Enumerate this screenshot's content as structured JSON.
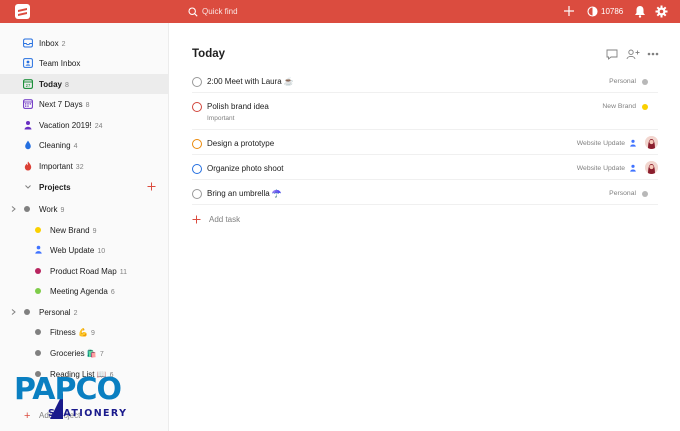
{
  "header": {
    "search_placeholder": "Quick find",
    "karma": "10786",
    "accent": "#db4c3f"
  },
  "sidebar": {
    "nav": [
      {
        "label": "Inbox",
        "count": "2",
        "icon": "inbox-icon",
        "color": "#246fe0"
      },
      {
        "label": "Team Inbox",
        "count": "",
        "icon": "team-inbox-icon",
        "color": "#246fe0"
      },
      {
        "label": "Today",
        "count": "8",
        "icon": "calendar-today-icon",
        "color": "#058527",
        "day": "27"
      },
      {
        "label": "Next 7 Days",
        "count": "8",
        "icon": "calendar-week-icon",
        "color": "#692fc2"
      },
      {
        "label": "Vacation 2019!",
        "count": "24",
        "icon": "person-icon",
        "color": "#692fc2"
      },
      {
        "label": "Cleaning",
        "count": "4",
        "icon": "drop-icon",
        "color": "#246fe0"
      },
      {
        "label": "Important",
        "count": "32",
        "icon": "flame-icon",
        "color": "#db4035"
      }
    ],
    "projects_label": "Projects",
    "projects": [
      {
        "label": "Work",
        "count": "9",
        "level": 0,
        "kind": "dot",
        "color": "#808080",
        "expandable": true
      },
      {
        "label": "New Brand",
        "count": "9",
        "level": 1,
        "kind": "dot",
        "color": "#fad000"
      },
      {
        "label": "Web Update",
        "count": "10",
        "level": 1,
        "kind": "person",
        "color": "#4073ff"
      },
      {
        "label": "Product Road Map",
        "count": "11",
        "level": 1,
        "kind": "dot",
        "color": "#b8255f"
      },
      {
        "label": "Meeting Agenda",
        "count": "6",
        "level": 1,
        "kind": "dot",
        "color": "#7ecc49"
      },
      {
        "label": "Personal",
        "count": "2",
        "level": 0,
        "kind": "dot",
        "color": "#808080",
        "expandable": true
      },
      {
        "label": "Fitness 💪",
        "count": "9",
        "level": 1,
        "kind": "dot",
        "color": "#808080"
      },
      {
        "label": "Groceries 🛍️",
        "count": "7",
        "level": 1,
        "kind": "dot",
        "color": "#808080"
      },
      {
        "label": "Reading List 📖",
        "count": "6",
        "level": 1,
        "kind": "dot",
        "color": "#808080"
      }
    ],
    "add_project": "Add Project"
  },
  "main": {
    "title": "Today",
    "tasks": [
      {
        "title": "2:00 Meet with Laura ☕",
        "sub": "",
        "priority_color": "#999999",
        "project": "Personal",
        "project_color": "#b8b8b8",
        "shared": false,
        "avatar": false
      },
      {
        "title": "Polish brand idea",
        "sub": "Important",
        "priority_color": "#d1453b",
        "project": "New Brand",
        "project_color": "#fad000",
        "shared": false,
        "avatar": false
      },
      {
        "title": "Design a prototype",
        "sub": "",
        "priority_color": "#eb8909",
        "project": "Website Update",
        "project_color": "#4073ff",
        "shared": true,
        "avatar": true
      },
      {
        "title": "Organize photo shoot",
        "sub": "",
        "priority_color": "#246fe0",
        "project": "Website Update",
        "project_color": "#4073ff",
        "shared": true,
        "avatar": true
      },
      {
        "title": "Bring an umbrella ☂️",
        "sub": "",
        "priority_color": "#999999",
        "project": "Personal",
        "project_color": "#b8b8b8",
        "shared": false,
        "avatar": false
      }
    ],
    "add_task": "Add task"
  },
  "watermark": {
    "brand": "PAPCO",
    "tagline": "STATIONERY"
  }
}
